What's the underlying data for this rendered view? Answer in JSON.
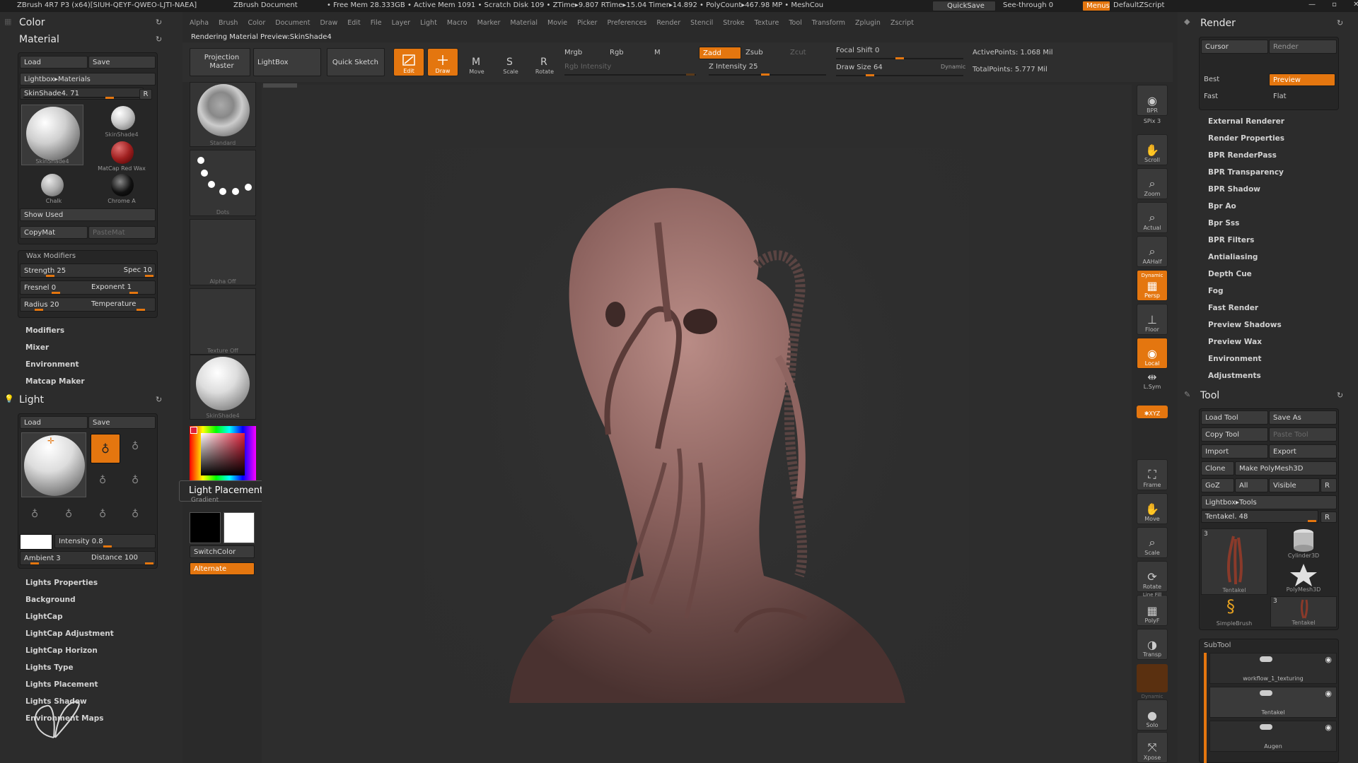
{
  "app": {
    "title": "ZBrush 4R7 P3 (x64)[SIUH-QEYF-QWEO-LJTI-NAEA]",
    "doc": "ZBrush Document",
    "stats": "• Free Mem 28.333GB • Active Mem 1091 • Scratch Disk 109 • ZTime▸9.807 RTime▸15.04 Timer▸14.892 • PolyCount▸467.98 MP • MeshCou",
    "quicksave": "QuickSave",
    "seethrough": "See-through  0",
    "menus": "Menus",
    "script": "DefaultZScript"
  },
  "menubar": [
    "Alpha",
    "Brush",
    "Color",
    "Document",
    "Draw",
    "Edit",
    "File",
    "Layer",
    "Light",
    "Macro",
    "Marker",
    "Material",
    "Movie",
    "Picker",
    "Preferences",
    "Render",
    "Stencil",
    "Stroke",
    "Texture",
    "Tool",
    "Transform",
    "Zplugin",
    "Zscript"
  ],
  "status_line": "Rendering Material Preview:SkinShade4",
  "toolbar": {
    "projection_master": "Projection Master",
    "lightbox": "LightBox",
    "quick_sketch": "Quick Sketch",
    "edit": "Edit",
    "draw": "Draw",
    "move": "Move",
    "scale": "Scale",
    "rotate": "Rotate",
    "mrgb": "Mrgb",
    "rgb": "Rgb",
    "m": "M",
    "rgb_intensity": "Rgb Intensity",
    "zadd": "Zadd",
    "zsub": "Zsub",
    "zcut": "Zcut",
    "z_intensity": "Z Intensity 25",
    "focal_shift": "Focal Shift 0",
    "draw_size": "Draw Size 64",
    "dynamic": "Dynamic",
    "active_points": "ActivePoints: 1.068  Mil",
    "total_points": "TotalPoints: 5.777  Mil"
  },
  "left": {
    "color_title": "Color",
    "material_title": "Material",
    "load": "Load",
    "save": "Save",
    "lightbox_materials": "Lightbox▸Materials",
    "skinshade_slider": "SkinShade4. 71",
    "r": "R",
    "mat1": "SkinShade4",
    "mat2": "SkinShade4",
    "mat3": "MatCap Red Wax",
    "mat4": "Chalk",
    "mat5": "Chrome A",
    "show_used": "Show Used",
    "copymat": "CopyMat",
    "pastemat": "PasteMat",
    "wax_modifiers": "Wax Modifiers",
    "strength": "Strength 25",
    "spec": "Spec 10",
    "fresnel": "Fresnel 0",
    "exponent": "Exponent 1",
    "radius": "Radius 20",
    "temperature": "Temperature",
    "material_items": [
      "Modifiers",
      "Mixer",
      "Environment",
      "Matcap Maker"
    ],
    "light_title": "Light",
    "light_load": "Load",
    "light_save": "Save",
    "intensity": "Intensity 0.8",
    "ambient": "Ambient 3",
    "distance": "Distance 100",
    "light_items": [
      "Lights Properties",
      "Background",
      "LightCap",
      "LightCap Adjustment",
      "LightCap Horizon",
      "Lights Type",
      "Lights Placement",
      "Lights Shadow",
      "Environment Maps"
    ]
  },
  "shelf": {
    "brush": "Standard",
    "stroke": "Dots",
    "alpha": "Alpha  Off",
    "texture": "Texture  Off",
    "material": "SkinShade4",
    "gradient": "Gradient",
    "switchcolor": "SwitchColor",
    "alternate": "Alternate",
    "tooltip": "Light Placement"
  },
  "rightshelf": {
    "bpr": "BPR",
    "spix": "SPix 3",
    "scroll": "Scroll",
    "zoom": "Zoom",
    "actual": "Actual",
    "aahalf": "AAHalf",
    "persp_top": "Dynamic",
    "persp": "Persp",
    "floor": "Floor",
    "local": "Local",
    "lsym": "L.Sym",
    "xyz": "✱XYZ",
    "frame": "Frame",
    "move": "Move",
    "scale": "Scale",
    "rotate": "Rotate",
    "linefill": "Line Fill",
    "polyf": "PolyF",
    "transp": "Transp",
    "dynamic": "Dynamic",
    "solo": "Solo",
    "xpose": "Xpose"
  },
  "right": {
    "render_title": "Render",
    "cursor": "Cursor",
    "render": "Render",
    "best": "Best",
    "preview": "Preview",
    "fast": "Fast",
    "flat": "Flat",
    "render_items": [
      "External Renderer",
      "Render Properties",
      "BPR RenderPass",
      "BPR Transparency",
      "BPR Shadow",
      "Bpr Ao",
      "Bpr Sss",
      "BPR Filters",
      "Antialiasing",
      "Depth Cue",
      "Fog",
      "Fast Render",
      "Preview Shadows",
      "Preview Wax",
      "Environment",
      "Adjustments"
    ],
    "tool_title": "Tool",
    "load_tool": "Load Tool",
    "save_as": "Save As",
    "copy_tool": "Copy Tool",
    "paste_tool": "Paste Tool",
    "import": "Import",
    "export": "Export",
    "clone": "Clone",
    "make_polymesh": "Make PolyMesh3D",
    "goz": "GoZ",
    "all": "All",
    "visible": "Visible",
    "r": "R",
    "lightbox_tools": "Lightbox▸Tools",
    "tentakel_slider": "Tentakel. 48",
    "tool1": "Tentakel",
    "tool1_count": "3",
    "tool2": "Cylinder3D",
    "tool3": "PolyMesh3D",
    "tool4": "SimpleBrush",
    "tool5": "Tentakel",
    "tool5_count": "3",
    "subtool": "SubTool",
    "subtools": [
      "workflow_1_texturing",
      "Tentakel",
      "Augen"
    ]
  },
  "colors": {
    "accent": "#e4760f",
    "panel": "#303030",
    "bg": "#2a2a2a"
  }
}
